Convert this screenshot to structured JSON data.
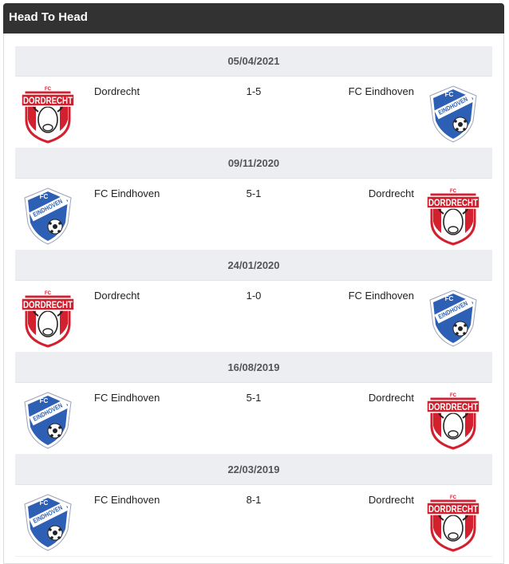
{
  "header": {
    "title": "Head To Head"
  },
  "colors": {
    "dordrecht_red": "#d2202f",
    "eindhoven_blue": "#2d5fb4",
    "header_bg": "#323232",
    "date_bg": "#eceef1"
  },
  "matches": [
    {
      "date": "05/04/2021",
      "home": "Dordrecht",
      "home_logo": "dordrecht-logo",
      "score": "1-5",
      "away": "FC Eindhoven",
      "away_logo": "eindhoven-logo"
    },
    {
      "date": "09/11/2020",
      "home": "FC Eindhoven",
      "home_logo": "eindhoven-logo",
      "score": "5-1",
      "away": "Dordrecht",
      "away_logo": "dordrecht-logo"
    },
    {
      "date": "24/01/2020",
      "home": "Dordrecht",
      "home_logo": "dordrecht-logo",
      "score": "1-0",
      "away": "FC Eindhoven",
      "away_logo": "eindhoven-logo"
    },
    {
      "date": "16/08/2019",
      "home": "FC Eindhoven",
      "home_logo": "eindhoven-logo",
      "score": "5-1",
      "away": "Dordrecht",
      "away_logo": "dordrecht-logo"
    },
    {
      "date": "22/03/2019",
      "home": "FC Eindhoven",
      "home_logo": "eindhoven-logo",
      "score": "8-1",
      "away": "Dordrecht",
      "away_logo": "dordrecht-logo"
    }
  ],
  "logo_text": {
    "dordrecht": {
      "fc": "FC",
      "name": "DORDRECHT"
    },
    "eindhoven": {
      "fc": "FC",
      "name": "EINDHOVEN"
    }
  }
}
